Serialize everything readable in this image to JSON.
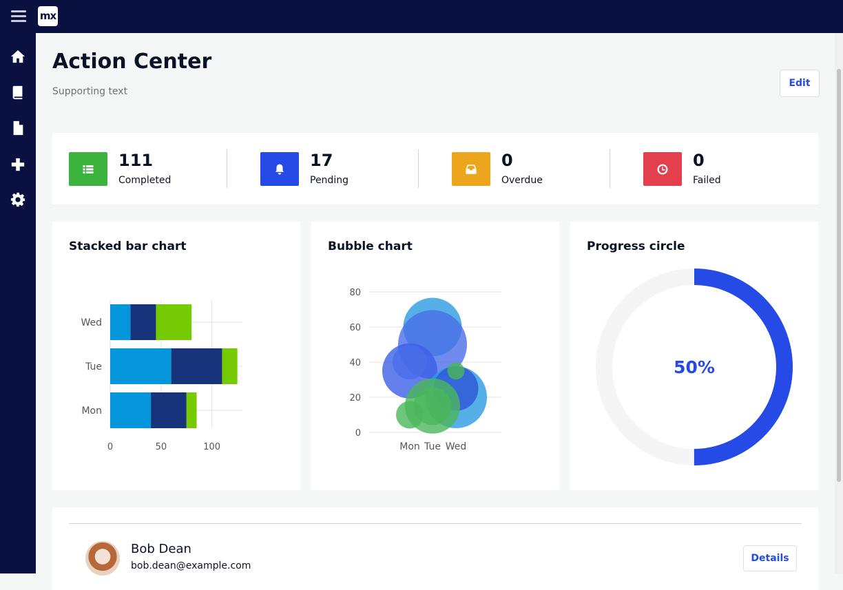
{
  "app": {
    "logo_text": "mx",
    "brand_color": "#0a1141",
    "accent_color": "#264ae5"
  },
  "sidebar": {
    "items": [
      {
        "icon": "home-icon"
      },
      {
        "icon": "book-icon"
      },
      {
        "icon": "file-icon"
      },
      {
        "icon": "plus-icon"
      },
      {
        "icon": "gear-icon"
      }
    ]
  },
  "header": {
    "title": "Action Center",
    "subtitle": "Supporting text",
    "edit_label": "Edit"
  },
  "stats": [
    {
      "value": "111",
      "label": "Completed",
      "color": "#3cb33d",
      "icon": "list-icon"
    },
    {
      "value": "17",
      "label": "Pending",
      "color": "#264ae5",
      "icon": "bell-icon"
    },
    {
      "value": "0",
      "label": "Overdue",
      "color": "#eca51c",
      "icon": "inbox-icon"
    },
    {
      "value": "0",
      "label": "Failed",
      "color": "#e33f4e",
      "icon": "clock-icon"
    }
  ],
  "charts": {
    "bar_title": "Stacked bar chart",
    "bubble_title": "Bubble chart",
    "progress_title": "Progress circle",
    "progress_label": "50%"
  },
  "chart_data": [
    {
      "type": "bar",
      "orientation": "horizontal",
      "stacked": true,
      "title": "Stacked bar chart",
      "categories": [
        "Mon",
        "Tue",
        "Wed"
      ],
      "series": [
        {
          "color": "#0595db",
          "values": [
            40,
            60,
            20
          ]
        },
        {
          "color": "#17347b",
          "values": [
            35,
            50,
            25
          ]
        },
        {
          "color": "#76ca02",
          "values": [
            10,
            15,
            35
          ]
        }
      ],
      "xlim": [
        0,
        130
      ],
      "xticks": [
        0,
        50,
        100
      ],
      "grid": true
    },
    {
      "type": "scatter",
      "subtype": "bubble",
      "title": "Bubble chart",
      "x_categories": [
        "Mon",
        "Tue",
        "Wed"
      ],
      "ylim": [
        0,
        80
      ],
      "yticks": [
        0,
        20,
        40,
        60,
        80
      ],
      "grid": true,
      "points": [
        {
          "x": "Tue",
          "y": 60,
          "size": 17,
          "color": "#2c9be0"
        },
        {
          "x": "Tue",
          "y": 50,
          "size": 20,
          "color": "#4a6ee8"
        },
        {
          "x": "Mon",
          "y": 35,
          "size": 16,
          "color": "#3c5fe6"
        },
        {
          "x": "Mon",
          "y": 40,
          "size": 10,
          "color": "#4a6ee8"
        },
        {
          "x": "Wed",
          "y": 20,
          "size": 18,
          "color": "#2c9be0"
        },
        {
          "x": "Wed",
          "y": 25,
          "size": 13,
          "color": "#2d55d8"
        },
        {
          "x": "Tue",
          "y": 15,
          "size": 16,
          "color": "#4bb65a"
        },
        {
          "x": "Tue",
          "y": 15,
          "size": 11,
          "color": "#4bb65a"
        },
        {
          "x": "Mon",
          "y": 10,
          "size": 8,
          "color": "#4bb65a"
        },
        {
          "x": "Wed",
          "y": 35,
          "size": 5,
          "color": "#4bb65a"
        }
      ]
    },
    {
      "type": "pie",
      "subtype": "progress-circle",
      "title": "Progress circle",
      "value": 0.5,
      "label": "50%",
      "color": "#264ae5",
      "track_color": "#f5f5f5"
    }
  ],
  "user": {
    "name": "Bob Dean",
    "email": "bob.dean@example.com",
    "details_label": "Details"
  }
}
